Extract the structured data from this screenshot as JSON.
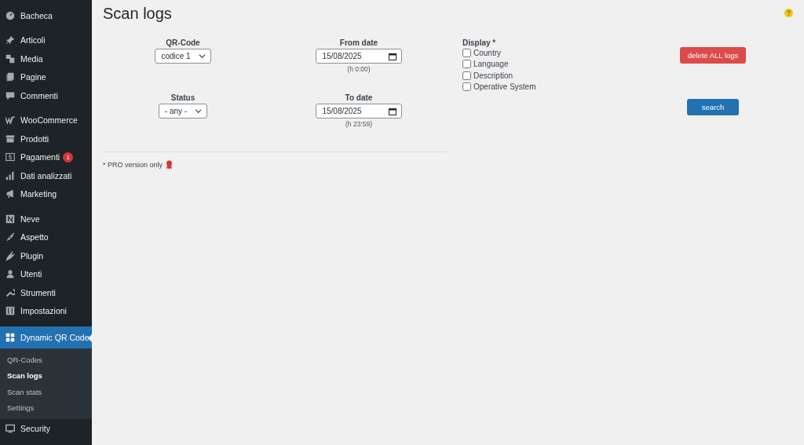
{
  "sidebar": {
    "groups": [
      {
        "items": [
          {
            "label": "Bacheca",
            "selected": false
          }
        ]
      },
      {
        "items": [
          {
            "label": "Articoli",
            "selected": false
          },
          {
            "label": "Media",
            "selected": false
          },
          {
            "label": "Pagine",
            "selected": false
          },
          {
            "label": "Commenti",
            "selected": false
          }
        ]
      },
      {
        "items": [
          {
            "label": "WooCommerce",
            "selected": false
          },
          {
            "label": "Prodotti",
            "selected": false
          },
          {
            "label": "Pagamenti",
            "selected": false,
            "badge": "1"
          },
          {
            "label": "Dati analizzati",
            "selected": false
          },
          {
            "label": "Marketing",
            "selected": false
          }
        ]
      },
      {
        "items": [
          {
            "label": "Neve",
            "selected": false
          },
          {
            "label": "Aspetto",
            "selected": false
          },
          {
            "label": "Plugin",
            "selected": false
          },
          {
            "label": "Utenti",
            "selected": false
          },
          {
            "label": "Strumenti",
            "selected": false
          },
          {
            "label": "Impostazioni",
            "selected": false
          }
        ]
      },
      {
        "items": [
          {
            "label": "Dynamic QR Code",
            "selected": true,
            "children": [
              {
                "label": "QR-Codes",
                "selected": false
              },
              {
                "label": "Scan logs",
                "selected": true
              },
              {
                "label": "Scan stats",
                "selected": false
              },
              {
                "label": "Settings",
                "selected": false
              }
            ]
          },
          {
            "label": "Security",
            "selected": false
          }
        ]
      }
    ]
  },
  "page": {
    "title": "Scan logs",
    "qr_code": {
      "label": "QR-Code",
      "value": "codice 1"
    },
    "status": {
      "label": "Status",
      "value": "- any -"
    },
    "from_date": {
      "label": "From date",
      "value": "15/08/2025",
      "hint": "(h 0:00)"
    },
    "to_date": {
      "label": "To date",
      "value": "15/08/2025",
      "hint": "(h 23:59)"
    },
    "display": {
      "label": "Display *",
      "options": [
        {
          "label": "Country",
          "checked": false
        },
        {
          "label": "Language",
          "checked": false
        },
        {
          "label": "Description",
          "checked": false
        },
        {
          "label": "Operative System",
          "checked": false
        }
      ]
    },
    "buttons": {
      "delete": "delete ALL logs",
      "search": "search"
    },
    "footnote": "* PRO version only"
  }
}
